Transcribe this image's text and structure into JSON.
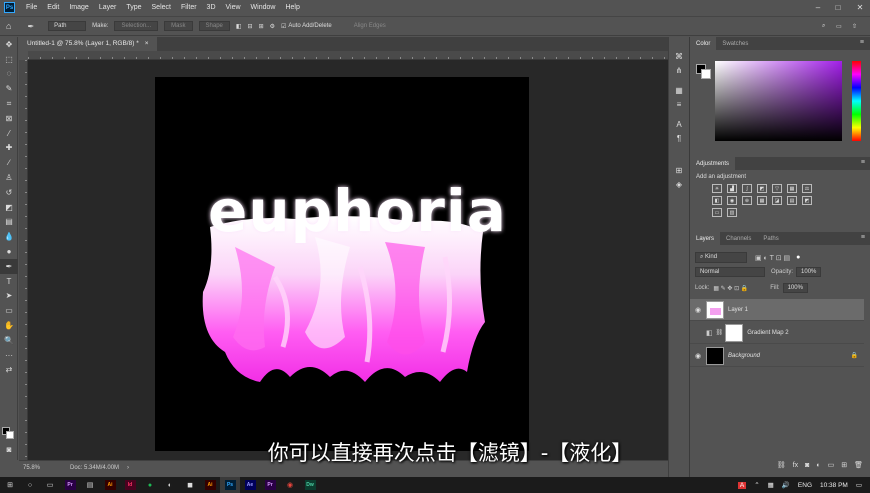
{
  "menubar": {
    "items": [
      "File",
      "Edit",
      "Image",
      "Layer",
      "Type",
      "Select",
      "Filter",
      "3D",
      "View",
      "Window",
      "Help"
    ]
  },
  "options": {
    "path_mode": "Path",
    "make_label": "Make:",
    "selection_btn": "Selection...",
    "mask_btn": "Mask",
    "shape_btn": "Shape",
    "auto_add_label": "Auto Add/Delete",
    "align_edges_label": "Align Edges"
  },
  "document": {
    "tab_title": "Untitled-1 @ 75.8% (Layer 1, RGB/8) *",
    "close": "×"
  },
  "artwork": {
    "text": "euphoria"
  },
  "subtitle": "你可以直接再次点击【滤镜】-【液化】",
  "status": {
    "zoom": "75.8%",
    "doc": "Doc: 5.34M/4.00M"
  },
  "panels": {
    "color_tabs": [
      "Color",
      "Swatches"
    ],
    "adjustments_tab": "Adjustments",
    "add_adjustment": "Add an adjustment",
    "layers_tabs": [
      "Layers",
      "Channels",
      "Paths"
    ],
    "kind": "Kind",
    "blend_mode": "Normal",
    "opacity_label": "Opacity:",
    "opacity_value": "100%",
    "lock_label": "Lock:",
    "fill_label": "Fill:",
    "fill_value": "100%",
    "layers": [
      {
        "name": "Layer 1",
        "selected": true
      },
      {
        "name": "Gradient Map 2",
        "selected": false
      },
      {
        "name": "Background",
        "selected": false
      }
    ]
  },
  "taskbar": {
    "lang": "ENG",
    "time": "10:38 PM"
  },
  "colors": {
    "accent_pink": "#ff35f0",
    "ps_blue": "#31a8ff",
    "panel_bg": "#535353"
  }
}
